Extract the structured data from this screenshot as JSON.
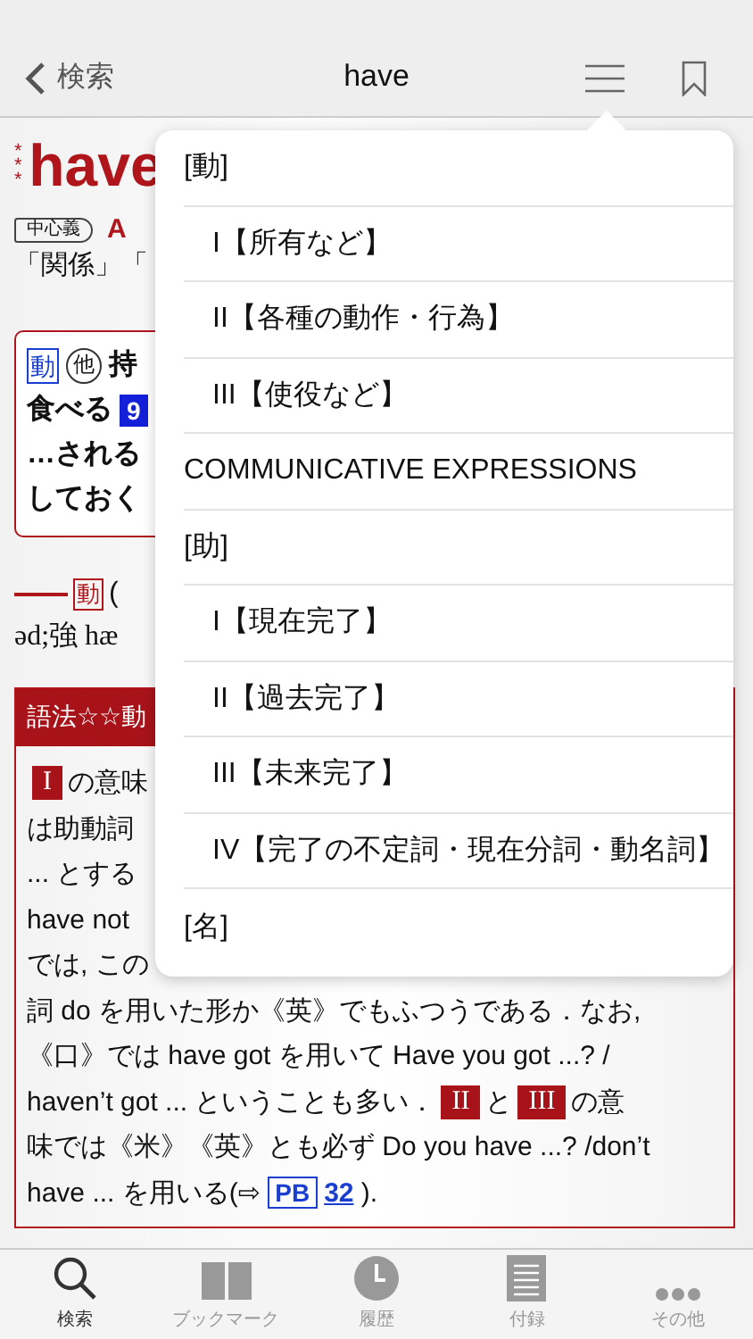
{
  "nav": {
    "back": "検索",
    "title": "have"
  },
  "entry": {
    "stars_mark": "***",
    "headword": "have",
    "core_badge": "中心義",
    "core_label": "A",
    "gloss": "「関係」「",
    "summary": [
      [
        {
          "kind": "pos",
          "text": "動"
        },
        {
          "kind": "circle",
          "text": "他"
        },
        {
          "kind": "text",
          "text": "持"
        }
      ],
      [
        {
          "kind": "text",
          "text": "食べる"
        },
        {
          "kind": "num",
          "text": "9"
        }
      ],
      [
        {
          "kind": "text",
          "text": "…される"
        }
      ],
      [
        {
          "kind": "text",
          "text": "しておく"
        }
      ]
    ],
    "pos_line": {
      "pos": "動",
      "text": "("
    },
    "pron": "əd;強 hæ",
    "usage": {
      "title": "語法☆☆動",
      "lines": [
        [
          {
            "kind": "badge",
            "text": "I"
          },
          {
            "kind": "text",
            "text": "の意味"
          }
        ],
        [
          {
            "kind": "text",
            "text": "は助動詞"
          }
        ],
        [
          {
            "kind": "text",
            "text": "... とする"
          }
        ],
        [
          {
            "kind": "text",
            "text": "have not"
          }
        ],
        [
          {
            "kind": "text",
            "text": "では, この"
          }
        ],
        [
          {
            "kind": "text",
            "text": "詞 do を用いた形か《英》でもふつうである．なお,"
          }
        ],
        [
          {
            "kind": "text",
            "text": "《口》では have got を用いて Have you got ...? /"
          }
        ],
        [
          {
            "kind": "text",
            "text": "haven’t got ... ということも多い．"
          },
          {
            "kind": "badge",
            "text": "II"
          },
          {
            "kind": "text",
            "text": "と"
          },
          {
            "kind": "badge",
            "text": "III"
          },
          {
            "kind": "text",
            "text": "の意"
          }
        ],
        [
          {
            "kind": "text",
            "text": "味では《米》《英》とも必ず Do you have ...? /don’t"
          }
        ],
        [
          {
            "kind": "text",
            "text": "have ... を用いる(⇨ "
          },
          {
            "kind": "refbox",
            "text": "PB"
          },
          {
            "kind": "link",
            "text": "32"
          },
          {
            "kind": "text",
            "text": " )."
          }
        ]
      ]
    }
  },
  "menu": {
    "items": [
      {
        "label": "[動]",
        "children": [
          {
            "label": "I【所有など】"
          },
          {
            "label": "II【各種の動作・行為】"
          },
          {
            "label": "III【使役など】"
          }
        ]
      },
      {
        "label": "COMMUNICATIVE EXPRESSIONS"
      },
      {
        "label": "[助]",
        "children": [
          {
            "label": "I【現在完了】"
          },
          {
            "label": "II【過去完了】"
          },
          {
            "label": "III【未来完了】"
          },
          {
            "label": "IV【完了の不定詞・現在分詞・動名詞】"
          }
        ]
      },
      {
        "label": "[名]"
      }
    ]
  },
  "tabs": [
    {
      "label": "検索",
      "kind": "search",
      "selected": true
    },
    {
      "label": "ブックマーク",
      "kind": "book",
      "selected": false
    },
    {
      "label": "履歴",
      "kind": "clock",
      "selected": false
    },
    {
      "label": "付録",
      "kind": "list",
      "selected": false
    },
    {
      "label": "その他",
      "kind": "more",
      "selected": false
    }
  ]
}
